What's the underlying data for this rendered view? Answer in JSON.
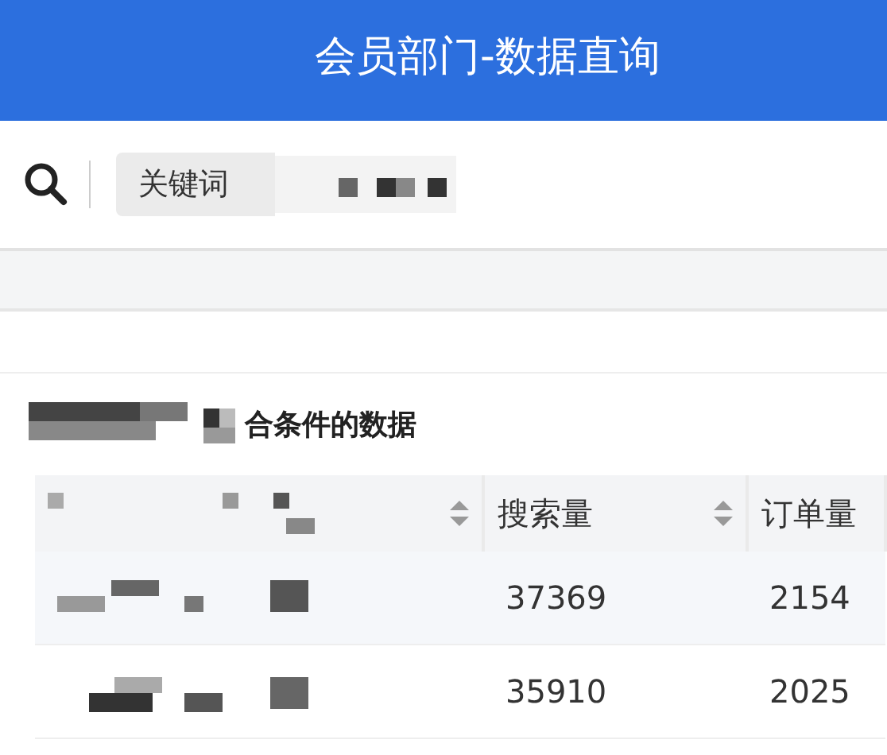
{
  "header": {
    "title": "会员部门-数据直询"
  },
  "search": {
    "placeholder": "关键词"
  },
  "results": {
    "heading": "合条件的数据"
  },
  "table": {
    "columns": [
      {
        "sortable": true
      },
      {
        "label": "搜索量",
        "sortable": true
      },
      {
        "label": "订单量"
      }
    ],
    "rows": [
      {
        "cells": [
          "",
          "37369",
          "2154"
        ]
      },
      {
        "cells": [
          "",
          "35910",
          "2025"
        ]
      }
    ]
  }
}
